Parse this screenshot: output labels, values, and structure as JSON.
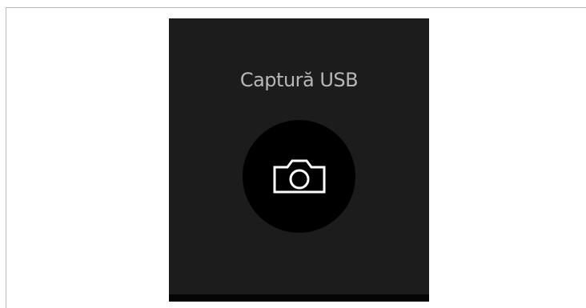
{
  "screen": {
    "title": "Captură USB"
  },
  "actions": {
    "capture_icon": "camera-icon"
  },
  "colors": {
    "screen_background": "#1c1c1c",
    "button_background": "#000000",
    "title_text": "#b7b7b7",
    "icon_stroke": "#ffffff"
  }
}
